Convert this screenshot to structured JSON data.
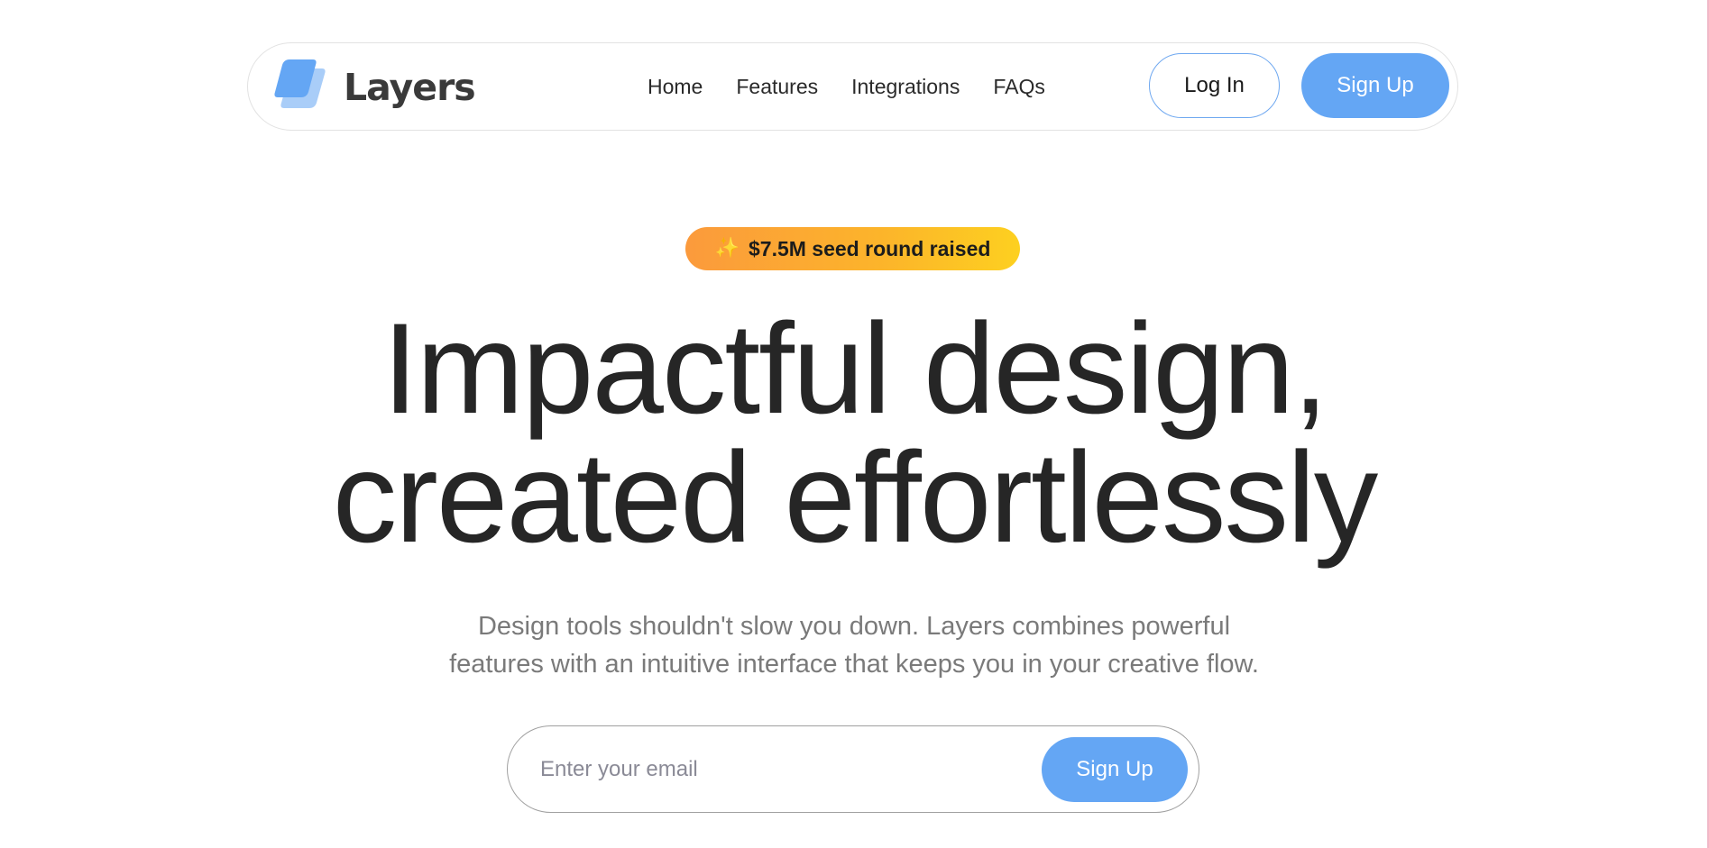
{
  "brand": {
    "name": "Layers",
    "accent": "#64a6f4",
    "accent_light": "#a9cdf8"
  },
  "nav": {
    "links": [
      "Home",
      "Features",
      "Integrations",
      "FAQs"
    ],
    "login_label": "Log In",
    "signup_label": "Sign Up"
  },
  "badge": {
    "icon": "sparkles-icon",
    "text": "$7.5M seed round raised"
  },
  "hero": {
    "headline_line1": "Impactful design,",
    "headline_line2": "created effortlessly",
    "subtext_line1": "Design tools shouldn't slow you down. Layers combines powerful",
    "subtext_line2": "features with an intuitive interface that keeps you in your creative flow."
  },
  "email_form": {
    "value": "",
    "placeholder": "Enter your email",
    "submit_label": "Sign Up"
  }
}
